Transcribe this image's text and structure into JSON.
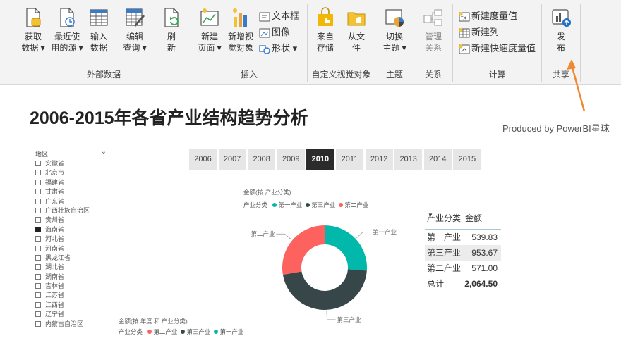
{
  "ribbon": {
    "external_data": {
      "label": "外部数据",
      "buttons": [
        {
          "line1": "获取",
          "line2": "数据 ▾"
        },
        {
          "line1": "最近使",
          "line2": "用的源 ▾"
        },
        {
          "line1": "输入",
          "line2": "数据"
        },
        {
          "line1": "编辑",
          "line2": "查询 ▾"
        },
        {
          "line1": "刷",
          "line2": "新"
        }
      ]
    },
    "insert": {
      "label": "插入",
      "buttons": [
        {
          "line1": "新建",
          "line2": "页面 ▾"
        },
        {
          "line1": "新增视",
          "line2": "觉对象"
        }
      ],
      "small": [
        "文本框",
        "图像",
        "形状 ▾"
      ]
    },
    "custom_visuals": {
      "label": "自定义视觉对象",
      "buttons": [
        {
          "line1": "来自",
          "line2": "存储"
        },
        {
          "line1": "从文",
          "line2": "件"
        }
      ]
    },
    "theme": {
      "label": "主题",
      "button": {
        "line1": "切换",
        "line2": "主题 ▾"
      }
    },
    "relations": {
      "label": "关系",
      "button": {
        "line1": "管理",
        "line2": "关系"
      }
    },
    "calc": {
      "label": "计算",
      "items": [
        "新建度量值",
        "新建列",
        "新建快速度量值"
      ]
    },
    "share": {
      "label": "共享",
      "button": {
        "line1": "发",
        "line2": "布"
      }
    }
  },
  "report": {
    "title": "2006-2015年各省产业结构趋势分析",
    "produced_by": "Produced by PowerBI星球",
    "slicer": {
      "header": "地区",
      "items": [
        {
          "label": "安徽省",
          "checked": false
        },
        {
          "label": "北京市",
          "checked": false
        },
        {
          "label": "福建省",
          "checked": false
        },
        {
          "label": "甘肃省",
          "checked": false
        },
        {
          "label": "广东省",
          "checked": false
        },
        {
          "label": "广西壮族自治区",
          "checked": false
        },
        {
          "label": "贵州省",
          "checked": false
        },
        {
          "label": "海南省",
          "checked": true
        },
        {
          "label": "河北省",
          "checked": false
        },
        {
          "label": "河南省",
          "checked": false
        },
        {
          "label": "黑龙江省",
          "checked": false
        },
        {
          "label": "湖北省",
          "checked": false
        },
        {
          "label": "湖南省",
          "checked": false
        },
        {
          "label": "吉林省",
          "checked": false
        },
        {
          "label": "江苏省",
          "checked": false
        },
        {
          "label": "江西省",
          "checked": false
        },
        {
          "label": "辽宁省",
          "checked": false
        },
        {
          "label": "内蒙古自治区",
          "checked": false
        }
      ]
    },
    "years": [
      "2006",
      "2007",
      "2008",
      "2009",
      "2010",
      "2011",
      "2012",
      "2013",
      "2014",
      "2015"
    ],
    "selected_year": "2010",
    "table": {
      "headers": [
        "产业分类",
        "金额"
      ],
      "rows": [
        {
          "name": "第一产业",
          "value": "539.83"
        },
        {
          "name": "第三产业",
          "value": "953.67"
        },
        {
          "name": "第二产业",
          "value": "571.00"
        }
      ],
      "total_label": "总计",
      "total_value": "2,064.50"
    },
    "bottom_chart": {
      "caption": "金额(按 年度 和 产业分类)",
      "legend_title": "产业分类",
      "legend": [
        "第二产业",
        "第三产业",
        "第一产业"
      ]
    }
  },
  "colors": {
    "primary": "#01b8aa",
    "secondary": "#374649",
    "tertiary": "#fd625e",
    "accent": "#f08a32"
  },
  "chart_data": {
    "type": "pie",
    "title": "金额(按 产业分类)",
    "legend_title": "产业分类",
    "categories": [
      "第一产业",
      "第三产业",
      "第二产业"
    ],
    "values": [
      539.83,
      953.67,
      571.0
    ],
    "colors": [
      "#01b8aa",
      "#374649",
      "#fd625e"
    ],
    "donut": true,
    "legend_position": "top-left"
  }
}
